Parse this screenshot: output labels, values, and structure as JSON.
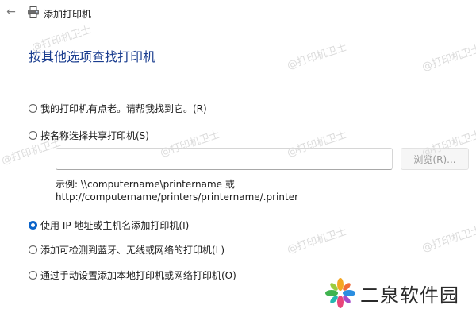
{
  "window": {
    "title": "添加打印机"
  },
  "heading": "按其他选项查找打印机",
  "options": [
    {
      "label": "我的打印机有点老。请帮我找到它。(R)",
      "checked": false
    },
    {
      "label": "按名称选择共享打印机(S)",
      "checked": false
    },
    {
      "label": "使用 IP 地址或主机名添加打印机(I)",
      "checked": true
    },
    {
      "label": "添加可检测到蓝牙、无线或网络的打印机(L)",
      "checked": false
    },
    {
      "label": "通过手动设置添加本地打印机或网络打印机(O)",
      "checked": false
    }
  ],
  "shared_printer": {
    "input_value": "",
    "browse_label": "浏览(R)...",
    "example_line1": "示例: \\\\computername\\printername 或",
    "example_line2": "http://computername/printers/printername/.printer"
  },
  "watermark": "@打印机卫士",
  "brand": {
    "text": "二泉软件园"
  },
  "colors": {
    "heading": "#1a3d8f",
    "accent": "#0a63c9"
  }
}
